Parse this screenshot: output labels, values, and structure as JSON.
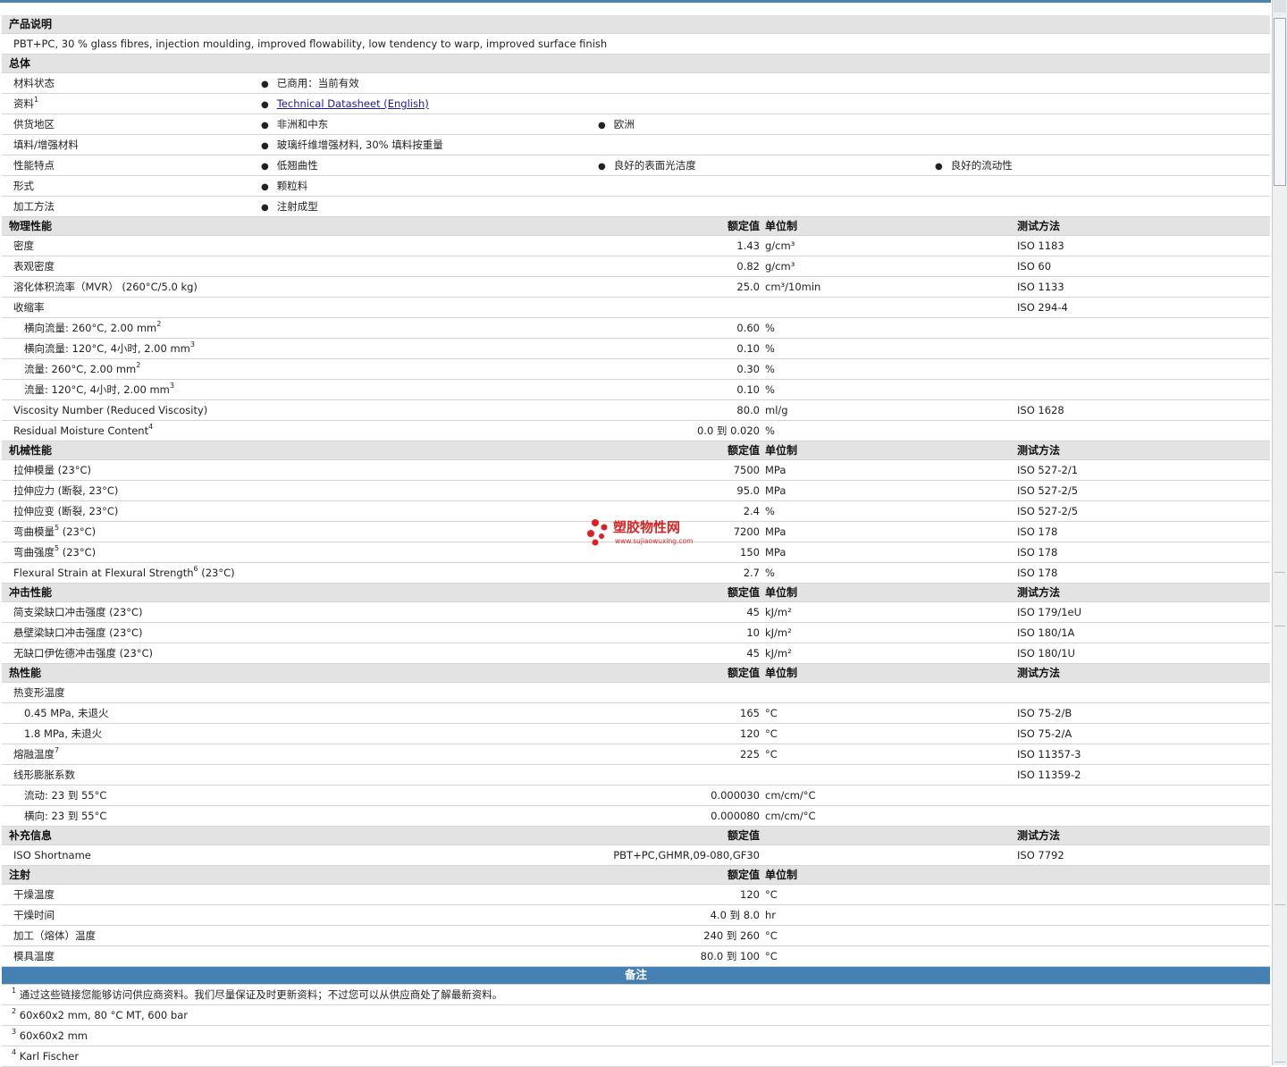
{
  "product_desc": {
    "header": "产品说明",
    "text": "PBT+PC, 30 % glass fibres, injection moulding, improved flowability, low tendency to warp, improved surface finish"
  },
  "general": {
    "header": "总体",
    "rows": [
      {
        "label": "材料状态",
        "bullets": [
          "已商用：当前有效"
        ]
      },
      {
        "label": "资料",
        "sup": "1",
        "link": "Technical Datasheet (English)"
      },
      {
        "label": "供货地区",
        "bullets": [
          "非洲和中东",
          "欧洲"
        ]
      },
      {
        "label": "填料/增强材料",
        "bullets": [
          "玻璃纤维增强材料, 30% 填料按重量"
        ]
      },
      {
        "label": "性能特点",
        "bullets": [
          "低翘曲性",
          "良好的表面光洁度",
          "良好的流动性"
        ]
      },
      {
        "label": "形式",
        "bullets": [
          "颗粒料"
        ]
      },
      {
        "label": "加工方法",
        "bullets": [
          "注射成型"
        ]
      }
    ]
  },
  "sections": [
    {
      "title": "物理性能",
      "col_val": "额定值",
      "col_unit": "单位制",
      "col_test": "测试方法",
      "rows": [
        {
          "label": "密度",
          "value": "1.43",
          "unit": "g/cm³",
          "test": "ISO 1183"
        },
        {
          "label": "表观密度",
          "value": "0.82",
          "unit": "g/cm³",
          "test": "ISO 60"
        },
        {
          "label": "溶化体积流率（MVR） (260°C/5.0 kg)",
          "value": "25.0",
          "unit": "cm³/10min",
          "test": "ISO 1133"
        },
        {
          "label": "收缩率",
          "value": "",
          "unit": "",
          "test": "ISO 294-4"
        },
        {
          "label": "横向流量: 260°C, 2.00 mm",
          "sup": "2",
          "indent": true,
          "value": "0.60",
          "unit": "%",
          "test": ""
        },
        {
          "label": "横向流量: 120°C, 4小时, 2.00 mm",
          "sup": "3",
          "indent": true,
          "value": "0.10",
          "unit": "%",
          "test": ""
        },
        {
          "label": "流量: 260°C, 2.00 mm",
          "sup": "2",
          "indent": true,
          "value": "0.30",
          "unit": "%",
          "test": ""
        },
        {
          "label": "流量: 120°C, 4小时, 2.00 mm",
          "sup": "3",
          "indent": true,
          "value": "0.10",
          "unit": "%",
          "test": ""
        },
        {
          "label": "Viscosity Number (Reduced Viscosity)",
          "value": "80.0",
          "unit": "ml/g",
          "test": "ISO 1628"
        },
        {
          "label": "Residual Moisture Content",
          "sup": "4",
          "value": "0.0 到 0.020",
          "unit": "%",
          "test": ""
        }
      ]
    },
    {
      "title": "机械性能",
      "col_val": "额定值",
      "col_unit": "单位制",
      "col_test": "测试方法",
      "rows": [
        {
          "label": "拉伸模量 (23°C)",
          "value": "7500",
          "unit": "MPa",
          "test": "ISO 527-2/1"
        },
        {
          "label": "拉伸应力 (断裂, 23°C)",
          "value": "95.0",
          "unit": "MPa",
          "test": "ISO 527-2/5"
        },
        {
          "label": "拉伸应变 (断裂, 23°C)",
          "value": "2.4",
          "unit": "%",
          "test": "ISO 527-2/5"
        },
        {
          "label": "弯曲模量",
          "sup": "5",
          "after": " (23°C)",
          "value": "7200",
          "unit": "MPa",
          "test": "ISO 178"
        },
        {
          "label": "弯曲强度",
          "sup": "5",
          "after": " (23°C)",
          "value": "150",
          "unit": "MPa",
          "test": "ISO 178"
        },
        {
          "label": "Flexural Strain at Flexural Strength",
          "sup": "6",
          "after": " (23°C)",
          "value": "2.7",
          "unit": "%",
          "test": "ISO 178"
        }
      ]
    },
    {
      "title": "冲击性能",
      "col_val": "额定值",
      "col_unit": "单位制",
      "col_test": "测试方法",
      "rows": [
        {
          "label": "简支梁缺口冲击强度 (23°C)",
          "value": "45",
          "unit": "kJ/m²",
          "test": "ISO 179/1eU"
        },
        {
          "label": "悬壁梁缺口冲击强度 (23°C)",
          "value": "10",
          "unit": "kJ/m²",
          "test": "ISO 180/1A"
        },
        {
          "label": "无缺口伊佐德冲击强度 (23°C)",
          "value": "45",
          "unit": "kJ/m²",
          "test": "ISO 180/1U"
        }
      ]
    },
    {
      "title": "热性能",
      "col_val": "额定值",
      "col_unit": "单位制",
      "col_test": "测试方法",
      "rows": [
        {
          "label": "热变形温度",
          "value": "",
          "unit": "",
          "test": ""
        },
        {
          "label": "0.45 MPa, 未退火",
          "indent": true,
          "value": "165",
          "unit": "°C",
          "test": "ISO 75-2/B"
        },
        {
          "label": "1.8 MPa, 未退火",
          "indent": true,
          "value": "120",
          "unit": "°C",
          "test": "ISO 75-2/A"
        },
        {
          "label": "熔融温度",
          "sup": "7",
          "value": "225",
          "unit": "°C",
          "test": "ISO 11357-3"
        },
        {
          "label": "线形膨胀系数",
          "value": "",
          "unit": "",
          "test": "ISO 11359-2"
        },
        {
          "label": "流动: 23 到 55°C",
          "indent": true,
          "value": "0.000030",
          "unit": "cm/cm/°C",
          "test": ""
        },
        {
          "label": "横向: 23 到 55°C",
          "indent": true,
          "value": "0.000080",
          "unit": "cm/cm/°C",
          "test": ""
        }
      ]
    },
    {
      "title": "补充信息",
      "col_val": "额定值",
      "col_unit": "",
      "col_test": "测试方法",
      "rows": [
        {
          "label": "ISO Shortname",
          "value": "PBT+PC,GHMR,09-080,GF30",
          "unit": "",
          "test": "ISO 7792"
        }
      ]
    },
    {
      "title": "注射",
      "col_val": "额定值",
      "col_unit": "单位制",
      "col_test": "",
      "rows": [
        {
          "label": "干燥温度",
          "value": "120",
          "unit": "°C",
          "test": ""
        },
        {
          "label": "干燥时间",
          "value": "4.0 到 8.0",
          "unit": "hr",
          "test": ""
        },
        {
          "label": "加工（熔体）温度",
          "value": "240 到 260",
          "unit": "°C",
          "test": ""
        },
        {
          "label": "模具温度",
          "value": "80.0 到 100",
          "unit": "°C",
          "test": ""
        }
      ]
    }
  ],
  "notes": {
    "header": "备注",
    "items": [
      {
        "num": "1",
        "text": "通过这些链接您能够访问供应商资料。我们尽量保证及时更新资料；不过您可以从供应商处了解最新资料。"
      },
      {
        "num": "2",
        "text": "60x60x2 mm, 80 °C MT, 600 bar"
      },
      {
        "num": "3",
        "text": "60x60x2 mm"
      },
      {
        "num": "4",
        "text": "Karl Fischer"
      }
    ]
  },
  "watermark": {
    "title": "塑胶物性网",
    "url": "www.sujiaowuxing.com"
  },
  "colors": {
    "accent": "#4580b3",
    "header_bg": "#e3e3e3",
    "link": "#1a1aa6",
    "watermark": "#dd2222"
  }
}
